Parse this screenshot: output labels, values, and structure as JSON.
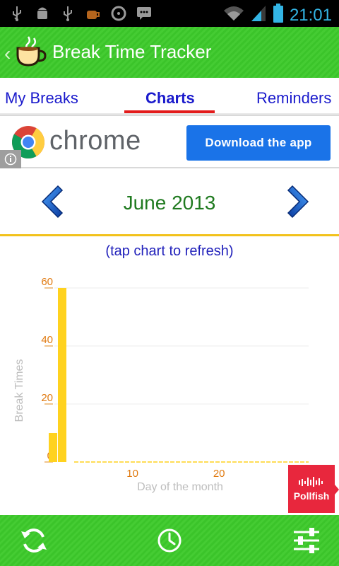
{
  "status_bar": {
    "time": "21:01",
    "left_icons": [
      "usb-icon",
      "android-debug-icon",
      "usb-icon",
      "coffee-icon",
      "sync-disc-icon",
      "chat-icon"
    ],
    "right_icons": [
      "wifi-icon",
      "signal-icon",
      "battery-icon"
    ]
  },
  "action_bar": {
    "title": "Break Time Tracker",
    "icon": "coffee-cup-icon",
    "color": "#3bc42a"
  },
  "tabs": [
    {
      "label": "My Breaks",
      "active": false
    },
    {
      "label": "Charts",
      "active": true
    },
    {
      "label": "Reminders",
      "active": false
    }
  ],
  "ad": {
    "brand": "chrome",
    "button_label": "Download the app",
    "info_icon": "info-icon"
  },
  "month_nav": {
    "month": "June 2013",
    "prev_icon": "chevron-left-icon",
    "next_icon": "chevron-right-icon"
  },
  "hint": "(tap chart to refresh)",
  "chart_data": {
    "type": "bar",
    "xlabel": "Day of the month",
    "ylabel": "Break Times",
    "x_ticks": [
      10,
      20
    ],
    "y_ticks": [
      0,
      20,
      40,
      60
    ],
    "xlim": [
      0,
      31
    ],
    "ylim": [
      0,
      60
    ],
    "grid": true,
    "bar_color": "#ffd21f",
    "bars": [
      {
        "day": 1,
        "value": 10
      },
      {
        "day": 2,
        "value": 60
      }
    ]
  },
  "pollfish": {
    "label": "Pollfish"
  },
  "bottom_bar": {
    "buttons": [
      "refresh-icon",
      "clock-icon",
      "settings-sliders-icon"
    ]
  }
}
